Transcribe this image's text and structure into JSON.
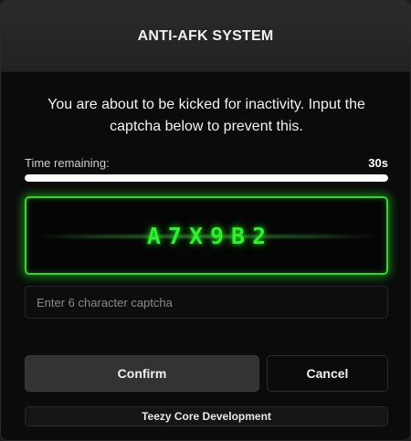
{
  "header": {
    "title": "ANTI-AFK SYSTEM"
  },
  "message": {
    "text": "You are about to be kicked for inactivity. Input the captcha below to prevent this."
  },
  "timer": {
    "label": "Time remaining:",
    "value": "30s",
    "progress_fraction": 1.0
  },
  "captcha": {
    "code": "A7X9B2",
    "accent_color": "#21e021"
  },
  "input": {
    "placeholder": "Enter 6 character captcha",
    "value": ""
  },
  "buttons": {
    "confirm_label": "Confirm",
    "cancel_label": "Cancel"
  },
  "footer": {
    "text": "Teezy Core Development"
  }
}
